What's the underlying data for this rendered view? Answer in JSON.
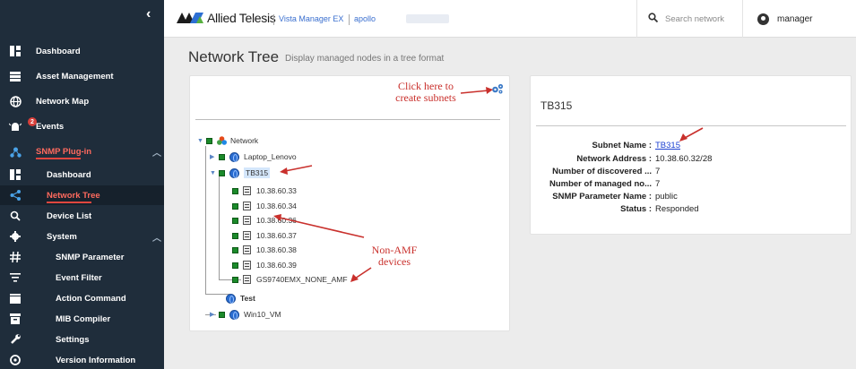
{
  "sidebar": {
    "collapse_icon": "chevron-left-icon",
    "items": [
      {
        "label": "Dashboard",
        "icon": "dashboard-icon"
      },
      {
        "label": "Asset Management",
        "icon": "table-icon"
      },
      {
        "label": "Network Map",
        "icon": "globe-icon"
      },
      {
        "label": "Events",
        "icon": "alarm-icon",
        "badge": "2"
      },
      {
        "label": "SNMP Plug-in",
        "icon": "snmp-icon"
      },
      {
        "label": "Dashboard",
        "icon": "dashboard-icon"
      },
      {
        "label": "Network Tree",
        "icon": "share-icon"
      },
      {
        "label": "Device List",
        "icon": "search-icon"
      },
      {
        "label": "System",
        "icon": "gear-icon"
      },
      {
        "label": "SNMP Parameter",
        "icon": "parameter-icon"
      },
      {
        "label": "Event Filter",
        "icon": "filter-icon"
      },
      {
        "label": "Action Command",
        "icon": "film-icon"
      },
      {
        "label": "MIB Compiler",
        "icon": "archive-icon"
      },
      {
        "label": "Settings",
        "icon": "wrench-icon"
      },
      {
        "label": "Version Information",
        "icon": "info-icon"
      }
    ]
  },
  "topbar": {
    "brand": "Allied Telesis",
    "product": "Vista Manager EX",
    "host": "apollo",
    "search_placeholder": "Search network",
    "user": "manager"
  },
  "page": {
    "title": "Network Tree",
    "subtitle": "Display managed nodes in a tree format"
  },
  "annotations": {
    "subnets": "Click here to\ncreate subnets",
    "non_amf": "Non-AMF\ndevices"
  },
  "tree": {
    "root": "Network",
    "nodes": [
      {
        "label": "Laptop_Lenovo"
      },
      {
        "label": "TB315"
      },
      {
        "label": "10.38.60.33"
      },
      {
        "label": "10.38.60.34"
      },
      {
        "label": "10.38.60.36"
      },
      {
        "label": "10.38.60.37"
      },
      {
        "label": "10.38.60.38"
      },
      {
        "label": "10.38.60.39"
      },
      {
        "label": "GS9740EMX_NONE_AMF"
      },
      {
        "label": "Test"
      },
      {
        "label": "Win10_VM"
      }
    ]
  },
  "details": {
    "title": "TB315",
    "rows": [
      {
        "key": "Subnet Name :",
        "value": "TB315"
      },
      {
        "key": "Network Address :",
        "value": "10.38.60.32/28"
      },
      {
        "key": "Number of discovered ...",
        "value": "7"
      },
      {
        "key": "Number of managed no...",
        "value": "7"
      },
      {
        "key": "SNMP Parameter Name :",
        "value": "public"
      },
      {
        "key": "Status :",
        "value": "Responded"
      }
    ]
  },
  "colors": {
    "sidebar_bg": "#1f2d3b",
    "accent_red": "#e0463f",
    "link_blue": "#1a3fd1",
    "status_ok": "#1b8a2a"
  }
}
